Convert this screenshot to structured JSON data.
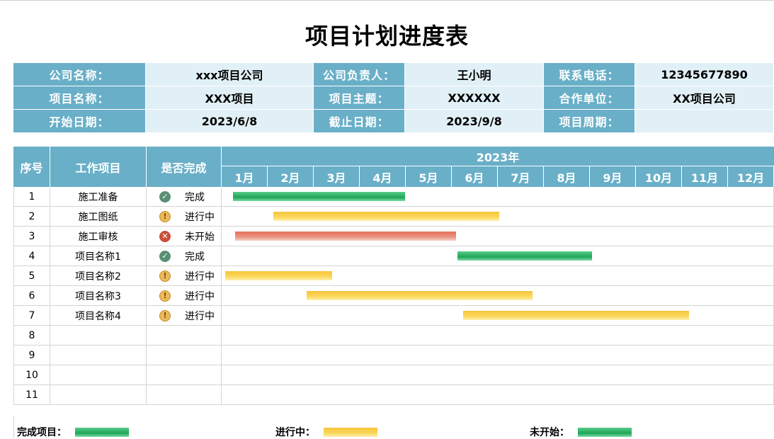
{
  "title": "项目计划进度表",
  "info": {
    "rows": [
      [
        {
          "label": "公司名称："
        },
        {
          "value": "xxx项目公司"
        },
        {
          "label": "公司负责人："
        },
        {
          "value": "王小明"
        },
        {
          "label": "联系电话："
        },
        {
          "value": "12345677890"
        }
      ],
      [
        {
          "label": "项目名称："
        },
        {
          "value": "XXX项目"
        },
        {
          "label": "项目主题："
        },
        {
          "value": "XXXXXX"
        },
        {
          "label": "合作单位："
        },
        {
          "value": "XX项目公司"
        }
      ],
      [
        {
          "label": "开始日期："
        },
        {
          "value": "2023/6/8"
        },
        {
          "label": "截止日期："
        },
        {
          "value": "2023/9/8"
        },
        {
          "label": "项目周期："
        },
        {
          "value": ""
        }
      ]
    ]
  },
  "gantt": {
    "headers": {
      "index": "序号",
      "task": "工作项目",
      "done": "是否完成",
      "year": "2023年"
    },
    "months": [
      "1月",
      "2月",
      "3月",
      "4月",
      "5月",
      "6月",
      "7月",
      "8月",
      "9月",
      "10月",
      "11月",
      "12月"
    ],
    "rows": [
      {
        "index": "1",
        "task": "施工准备",
        "status": "完成",
        "icon": "check-circle-icon",
        "bar": {
          "type": "done",
          "start_month": 1.25,
          "end_month": 4.99
        }
      },
      {
        "index": "2",
        "task": "施工图纸",
        "status": "进行中",
        "icon": "exclamation-circle-icon",
        "bar": {
          "type": "progress",
          "start_month": 2.13,
          "end_month": 7.03
        }
      },
      {
        "index": "3",
        "task": "施工审核",
        "status": "未开始",
        "icon": "x-circle-icon",
        "bar": {
          "type": "todo",
          "start_month": 1.29,
          "end_month": 6.1
        }
      },
      {
        "index": "4",
        "task": "项目名称1",
        "status": "完成",
        "icon": "check-circle-icon",
        "bar": {
          "type": "done",
          "start_month": 6.13,
          "end_month": 9.04
        }
      },
      {
        "index": "5",
        "task": "项目名称2",
        "status": "进行中",
        "icon": "exclamation-circle-icon",
        "bar": {
          "type": "progress",
          "start_month": 1.07,
          "end_month": 3.4
        }
      },
      {
        "index": "6",
        "task": "项目名称3",
        "status": "进行中",
        "icon": "exclamation-circle-icon",
        "bar": {
          "type": "progress",
          "start_month": 2.85,
          "end_month": 7.76
        }
      },
      {
        "index": "7",
        "task": "项目名称4",
        "status": "进行中",
        "icon": "exclamation-circle-icon",
        "bar": {
          "type": "progress",
          "start_month": 6.24,
          "end_month": 11.15
        }
      },
      {
        "index": "8",
        "task": "",
        "status": "",
        "icon": "",
        "bar": null
      },
      {
        "index": "9",
        "task": "",
        "status": "",
        "icon": "",
        "bar": null
      },
      {
        "index": "10",
        "task": "",
        "status": "",
        "icon": "",
        "bar": null
      },
      {
        "index": "11",
        "task": "",
        "status": "",
        "icon": "",
        "bar": null
      }
    ]
  },
  "legend": [
    {
      "label": "完成项目：",
      "type": "done"
    },
    {
      "label": "进行中：",
      "type": "progress"
    },
    {
      "label": "未开始：",
      "type": "done"
    }
  ],
  "colors": {
    "header": "#6aafc8",
    "value_bg": "#e1f0f6",
    "done": "#2bb36a",
    "progress": "#f7c53b",
    "todo": "#e67a66"
  }
}
